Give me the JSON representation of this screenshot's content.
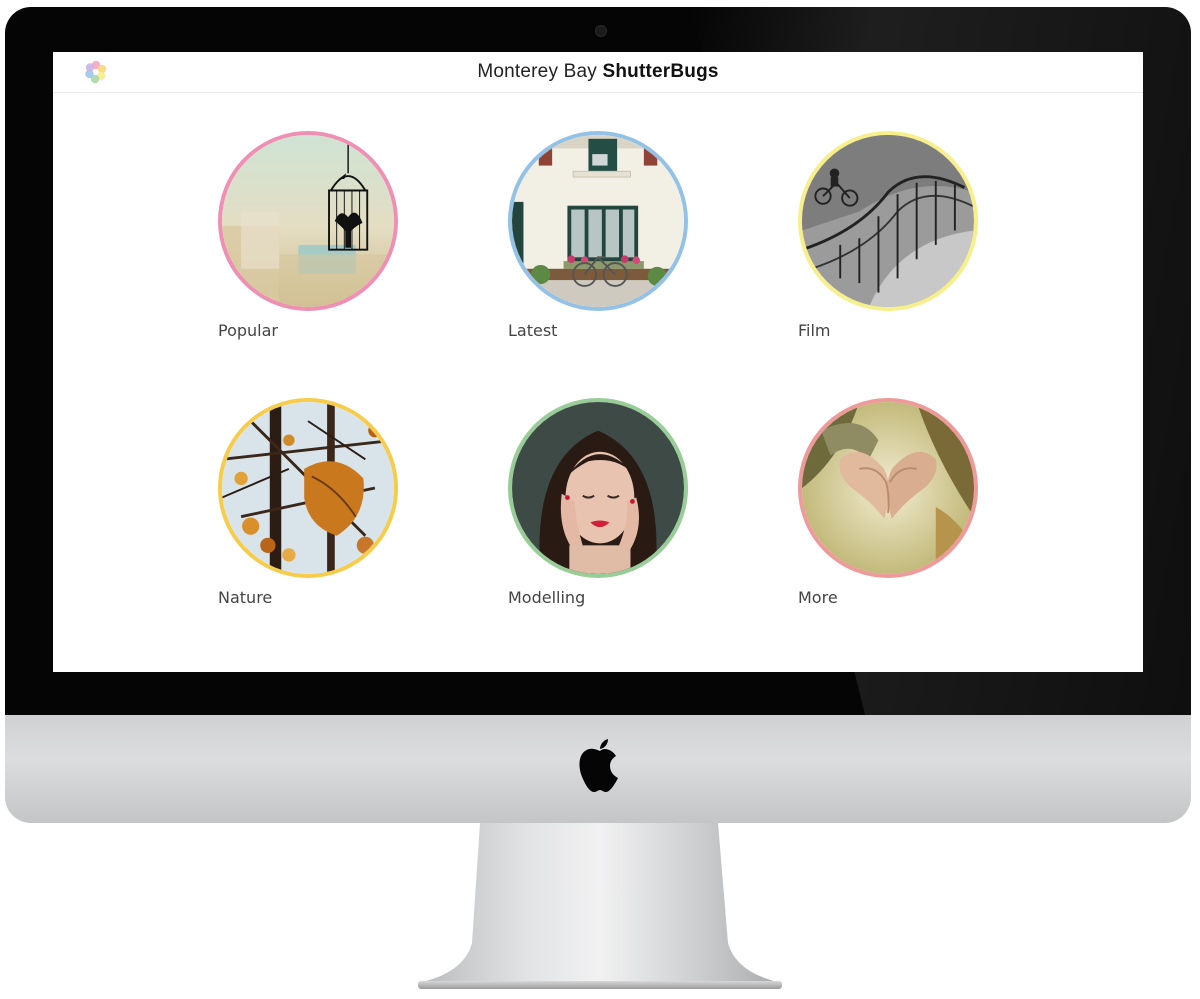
{
  "header": {
    "title_regular": "Monterey Bay ",
    "title_bold": "ShutterBugs"
  },
  "colors": {
    "popular": "#ef8fb3",
    "latest": "#93c2e6",
    "film": "#f7ef8a",
    "nature": "#f6cc4a",
    "modelling": "#99cd97",
    "more": "#ef9a9a"
  },
  "categories": [
    {
      "label": "Popular",
      "icon": "birdcage-photo"
    },
    {
      "label": "Latest",
      "icon": "building-bicycle-photo"
    },
    {
      "label": "Film",
      "icon": "spiral-staircase-photo"
    },
    {
      "label": "Nature",
      "icon": "autumn-leaves-photo"
    },
    {
      "label": "Modelling",
      "icon": "model-portrait-photo"
    },
    {
      "label": "More",
      "icon": "heart-hands-photo"
    }
  ]
}
